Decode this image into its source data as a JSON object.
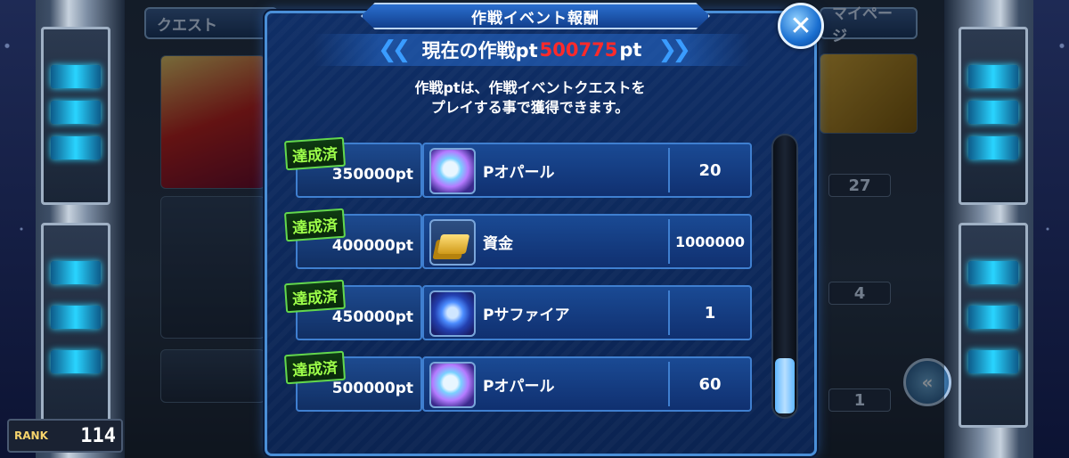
{
  "modal": {
    "title": "作戦イベント報酬",
    "current_pt_prefix": "現在の作戦pt",
    "current_pt_value": "500775",
    "current_pt_suffix": "pt",
    "description_line1": "作戦ptは、作戦イベントクエストを",
    "description_line2": "プレイする事で獲得できます。",
    "close_icon": "close-icon",
    "rewards": [
      {
        "badge": "達成済",
        "points": "350000pt",
        "item": "Pオパール",
        "icon": "opal-icon",
        "qty": "20"
      },
      {
        "badge": "達成済",
        "points": "400000pt",
        "item": "資金",
        "icon": "gold-icon",
        "qty": "1000000"
      },
      {
        "badge": "達成済",
        "points": "450000pt",
        "item": "Pサファイア",
        "icon": "sapphire-icon",
        "qty": "1"
      },
      {
        "badge": "達成済",
        "points": "500000pt",
        "item": "Pオパール",
        "icon": "opal-icon",
        "qty": "60"
      }
    ]
  },
  "background": {
    "quest_tab": "クエスト",
    "mypage_tab": "マイページ",
    "rank_label": "RANK",
    "rank_value": "114",
    "right_values": [
      "27",
      "4",
      "1"
    ]
  },
  "colors": {
    "accent_red": "#ff2a2a",
    "badge_green": "#9dff4a",
    "modal_blue": "#0f2e66"
  }
}
